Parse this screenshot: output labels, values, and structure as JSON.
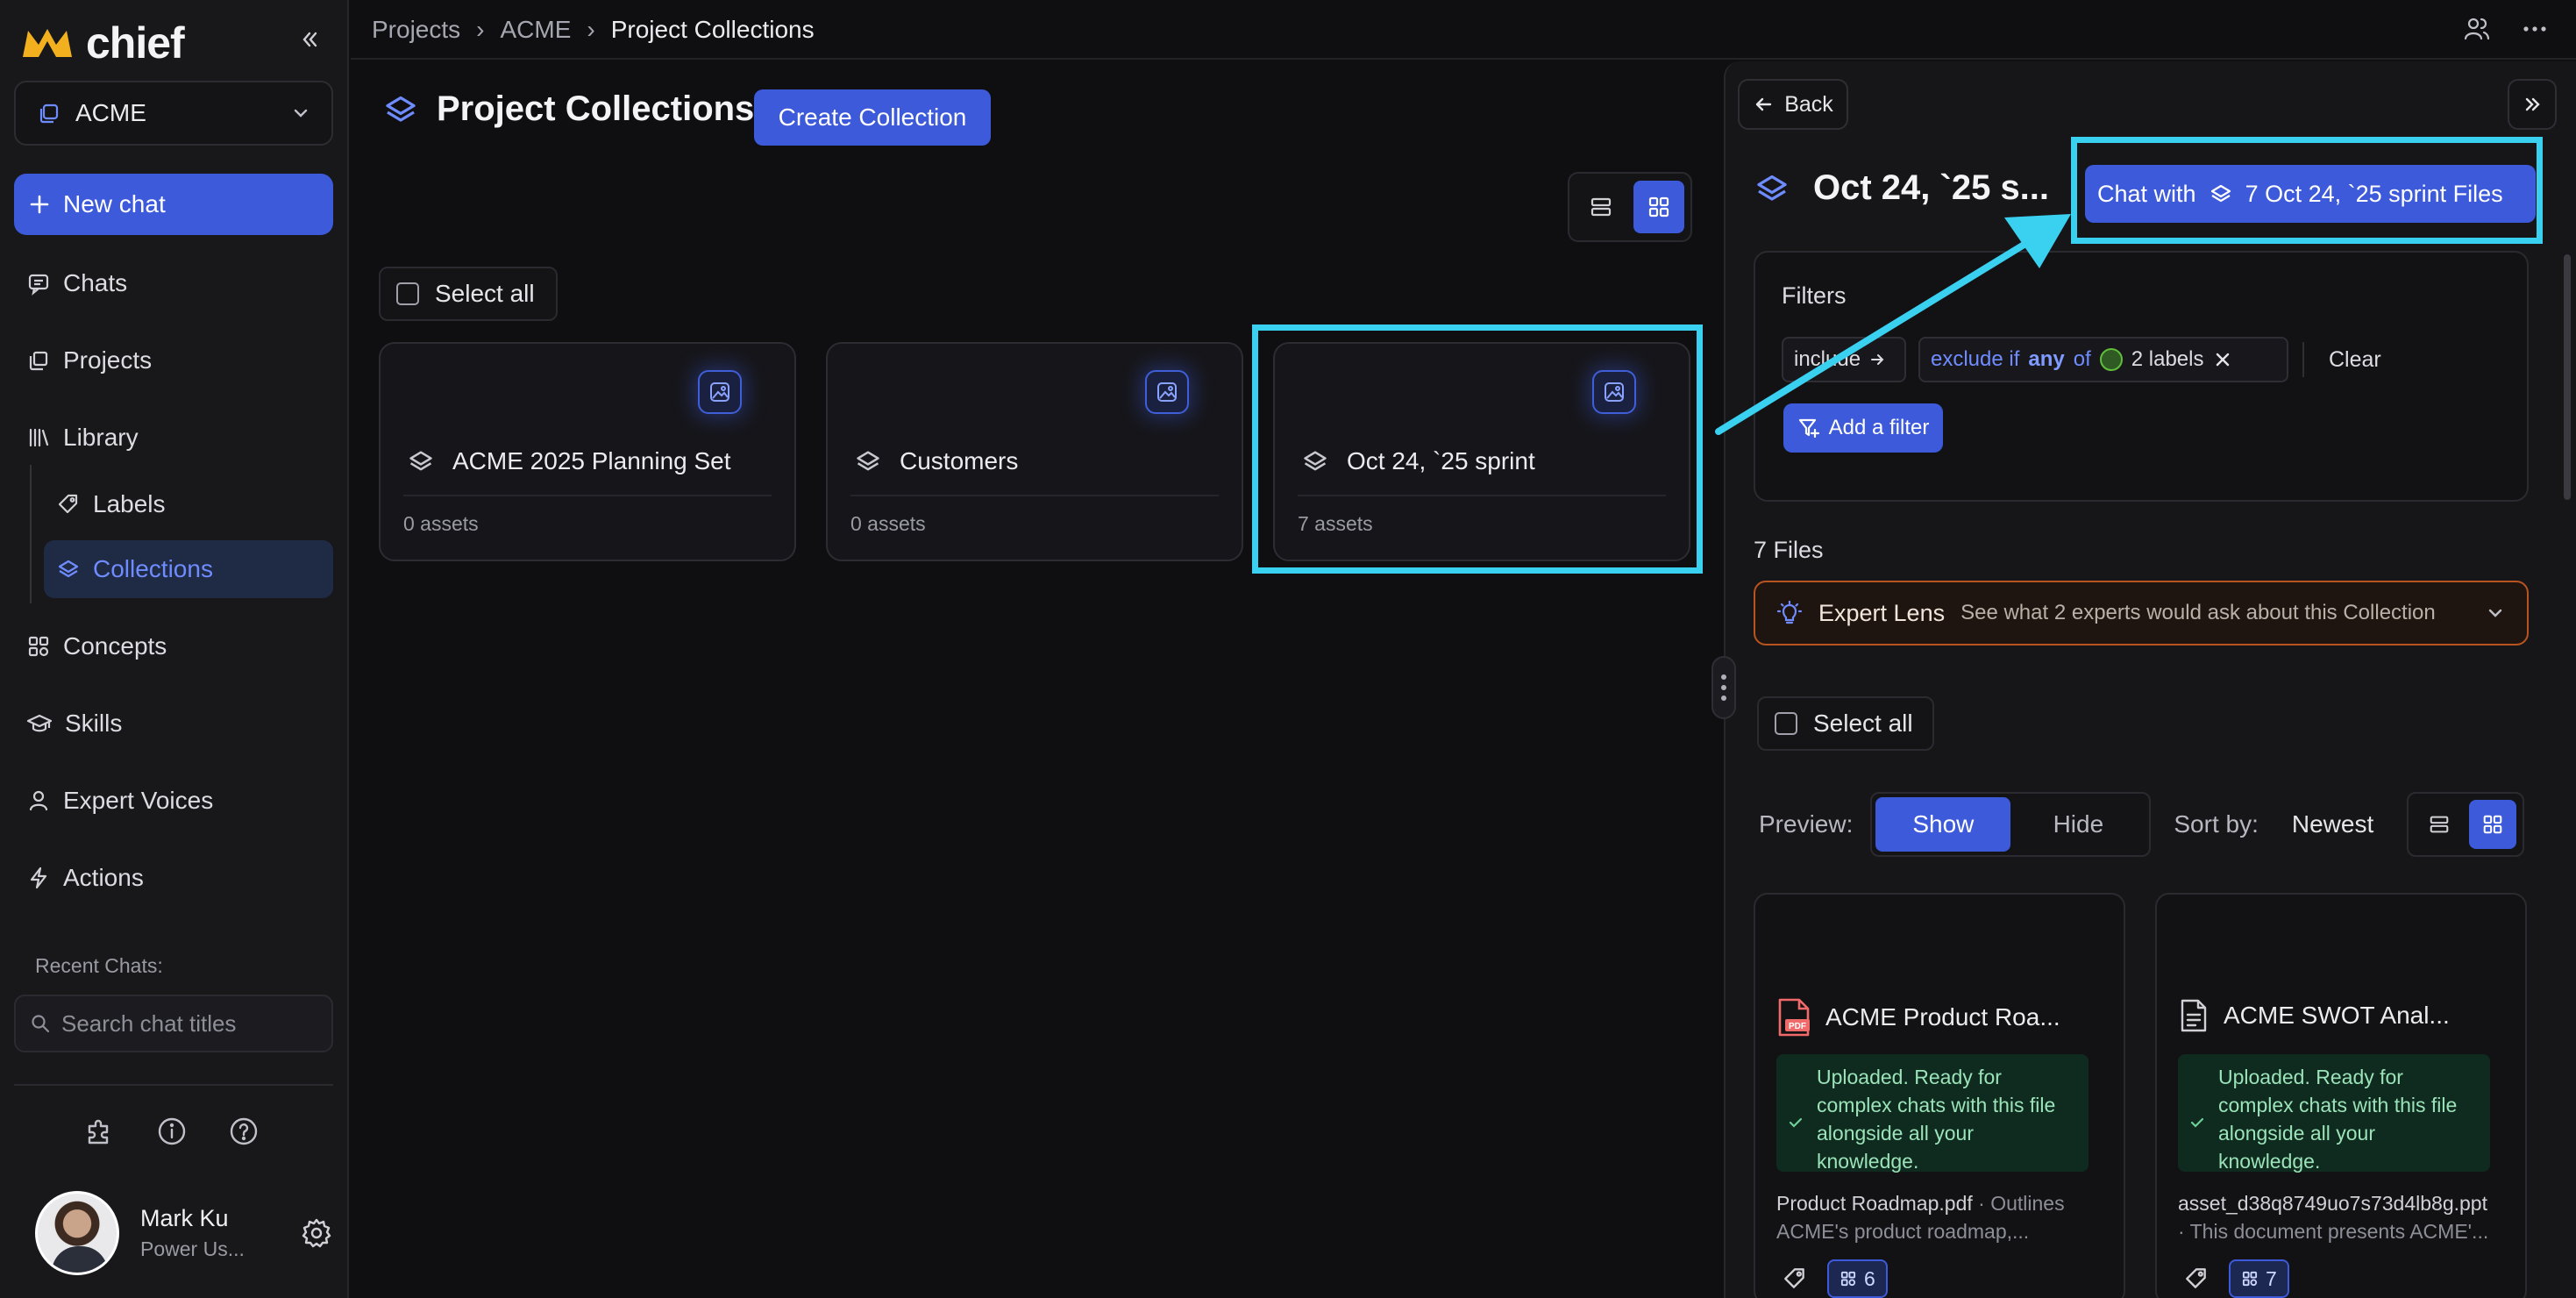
{
  "app": {
    "name": "chief"
  },
  "sidebar": {
    "workspace": "ACME",
    "new_chat": "New chat",
    "items": [
      {
        "label": "Chats",
        "icon": "chat-icon"
      },
      {
        "label": "Projects",
        "icon": "projects-icon"
      },
      {
        "label": "Library",
        "icon": "library-icon"
      },
      {
        "label": "Labels",
        "icon": "tag-icon"
      },
      {
        "label": "Collections",
        "icon": "layers-icon",
        "active": true
      },
      {
        "label": "Concepts",
        "icon": "concepts-icon"
      },
      {
        "label": "Skills",
        "icon": "graduation-cap-icon"
      },
      {
        "label": "Expert Voices",
        "icon": "person-icon"
      },
      {
        "label": "Actions",
        "icon": "bolt-icon"
      }
    ],
    "recent_label": "Recent Chats:",
    "search_placeholder": "Search chat titles",
    "user": {
      "name": "Mark Ku",
      "role": "Power Us..."
    }
  },
  "breadcrumb": {
    "items": [
      "Projects",
      "ACME"
    ],
    "current": "Project Collections"
  },
  "main": {
    "title": "Project Collections",
    "create_button": "Create Collection",
    "select_all": "Select all",
    "collections": [
      {
        "name": "ACME 2025 Planning Set",
        "assets": "0 assets"
      },
      {
        "name": "Customers",
        "assets": "0 assets"
      },
      {
        "name": "Oct 24, `25 sprint",
        "assets": "7 assets",
        "highlighted": true
      }
    ]
  },
  "panel": {
    "back": "Back",
    "title": "Oct 24, `25 s...",
    "chat_with": "Chat with",
    "chat_with_target": "7 Oct 24, `25 sprint Files",
    "filters": {
      "label": "Filters",
      "include": "include",
      "exclude_prefix": "exclude if",
      "exclude_any": "any",
      "exclude_of": "of",
      "labels_count": "2 labels",
      "clear": "Clear",
      "add_filter": "Add a filter"
    },
    "files_count": "7 Files",
    "expert_lens": {
      "title": "Expert Lens",
      "desc": "See what 2 experts would ask about this Collection"
    },
    "select_all": "Select all",
    "preview_label": "Preview:",
    "preview_show": "Show",
    "preview_hide": "Hide",
    "sort_label": "Sort by:",
    "sort_value": "Newest",
    "files": [
      {
        "name": "ACME Product Roa...",
        "status": "Uploaded. Ready for complex chats with this file alongside all your knowledge.",
        "filename": "Product Roadmap.pdf",
        "desc_1": " · Outlines",
        "desc_2": "ACME's product roadmap,...",
        "badge": "6",
        "icon": "pdf-file-icon"
      },
      {
        "name": "ACME SWOT Anal...",
        "status": "Uploaded. Ready for complex chats with this file alongside all your knowledge.",
        "filename": "asset_d38q8749uo7s73d4lb8g.ppt",
        "desc_1": "",
        "desc_2": "· This document presents ACME'...",
        "badge": "7",
        "icon": "document-icon"
      }
    ]
  },
  "colors": {
    "accent": "#3c5ad9",
    "highlight": "#3ad0f0",
    "expert_border": "#b8541f",
    "status_bg": "#0f2a1e"
  }
}
